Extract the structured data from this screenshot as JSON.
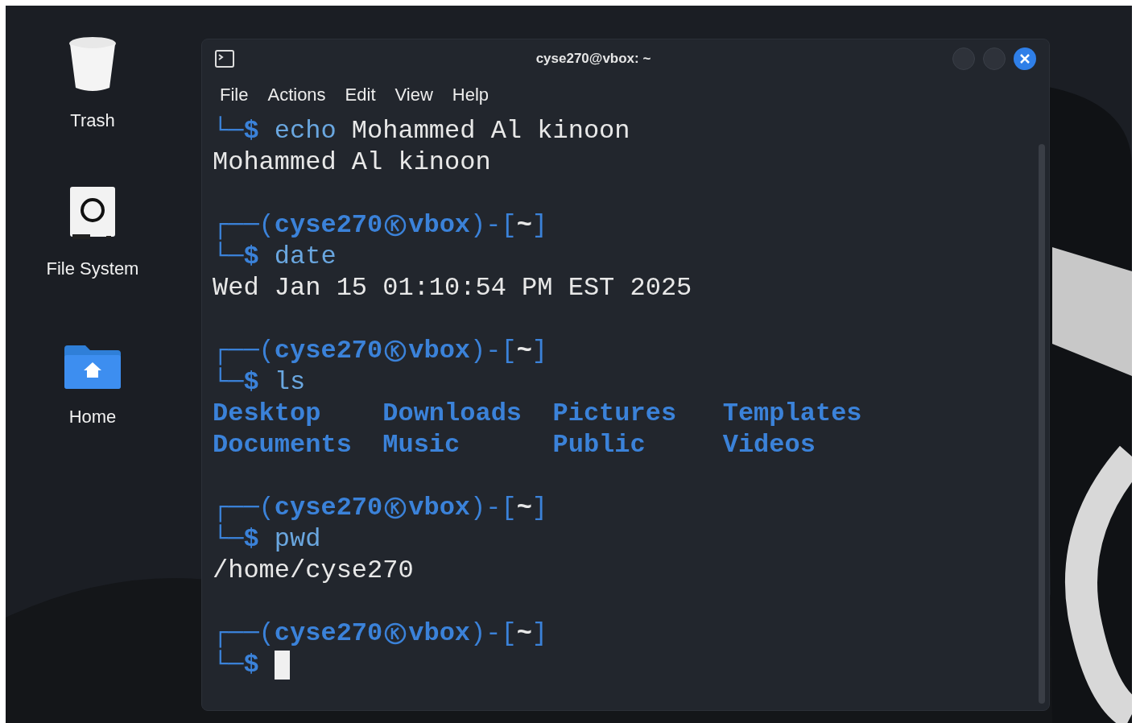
{
  "desktop_icons": [
    {
      "kind": "trash",
      "label": "Trash"
    },
    {
      "kind": "drive",
      "label": "File System"
    },
    {
      "kind": "home",
      "label": "Home"
    }
  ],
  "terminal": {
    "title": "cyse270@vbox: ~",
    "menu": [
      "File",
      "Actions",
      "Edit",
      "View",
      "Help"
    ],
    "lines": [
      {
        "kind": "command",
        "corner": "└─",
        "dollar": "$",
        "command": "echo",
        "args": "Mohammed Al kinoon"
      },
      {
        "kind": "output",
        "text": "Mohammed Al kinoon"
      },
      {
        "kind": "blank"
      },
      {
        "kind": "header",
        "open": "┌──(",
        "user": "cyse270",
        "host": "vbox",
        "mid": ")-[",
        "dir": "~",
        "close": "]"
      },
      {
        "kind": "command",
        "corner": "└─",
        "dollar": "$",
        "command": "date"
      },
      {
        "kind": "output",
        "text": "Wed Jan 15 01:10:54 PM EST 2025"
      },
      {
        "kind": "blank"
      },
      {
        "kind": "header",
        "open": "┌──(",
        "user": "cyse270",
        "host": "vbox",
        "mid": ")-[",
        "dir": "~",
        "close": "]"
      },
      {
        "kind": "command",
        "corner": "└─",
        "dollar": "$",
        "command": "ls"
      },
      {
        "kind": "listing",
        "rows": [
          [
            "Desktop",
            "Downloads",
            "Pictures",
            "Templates"
          ],
          [
            "Documents",
            "Music",
            "Public",
            "Videos"
          ]
        ]
      },
      {
        "kind": "blank"
      },
      {
        "kind": "header",
        "open": "┌──(",
        "user": "cyse270",
        "host": "vbox",
        "mid": ")-[",
        "dir": "~",
        "close": "]"
      },
      {
        "kind": "command",
        "corner": "└─",
        "dollar": "$",
        "command": "pwd"
      },
      {
        "kind": "output",
        "text": "/home/cyse270"
      },
      {
        "kind": "blank"
      },
      {
        "kind": "header",
        "open": "┌──(",
        "user": "cyse270",
        "host": "vbox",
        "mid": ")-[",
        "dir": "~",
        "close": "]"
      },
      {
        "kind": "command",
        "corner": "└─",
        "dollar": "$",
        "cursor": true
      }
    ]
  }
}
